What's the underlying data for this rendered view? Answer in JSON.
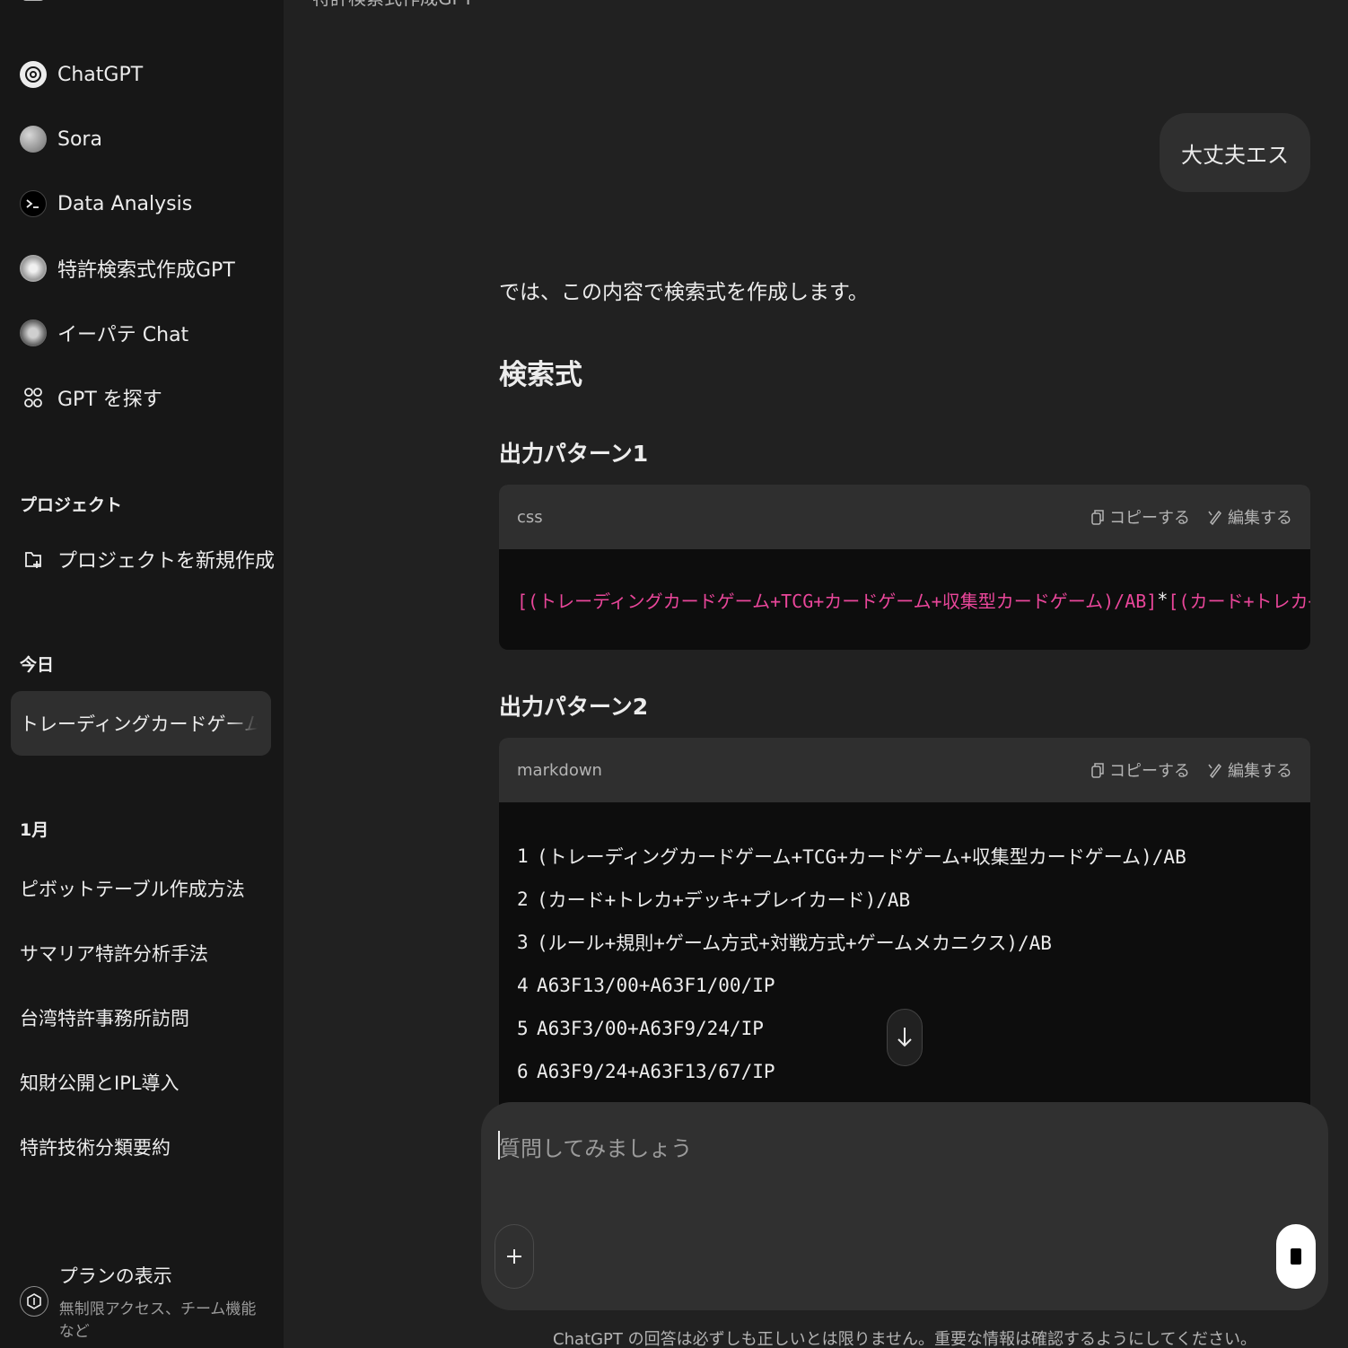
{
  "sidebar": {
    "gpts": [
      {
        "label": "ChatGPT",
        "icon": "openai-logo-icon"
      },
      {
        "label": "Sora",
        "icon": "sora-avatar"
      },
      {
        "label": "Data Analysis",
        "icon": "terminal-icon"
      },
      {
        "label": "特許検索式作成GPT",
        "icon": "gpt-avatar"
      },
      {
        "label": "イーパテ Chat",
        "icon": "gpt-avatar"
      },
      {
        "label": "GPT を探す",
        "icon": "grid-icon"
      }
    ],
    "projects_title": "プロジェクト",
    "new_project_label": "プロジェクトを新規作成",
    "today_title": "今日",
    "today_chats": [
      "トレーディングカードゲーム検索式"
    ],
    "month_title": "1月",
    "month_chats": [
      "ピボットテーブル作成方法",
      "サマリア特許分析手法",
      "台湾特許事務所訪問",
      "知財公開とIPL導入",
      "特許技術分類要約"
    ],
    "plan": {
      "title": "プランの表示",
      "subtitle": "無制限アクセス、チーム機能など"
    }
  },
  "main": {
    "header_title": "特許検索式作成GPT",
    "user_message": "大丈夫エス",
    "assistant_intro": "では、この内容で検索式を作成します。",
    "heading": "検索式",
    "pattern1_title": "出力パターン1",
    "pattern2_title": "出力パターン2",
    "code_actions": {
      "copy": "コピーする",
      "edit": "編集する"
    },
    "code1": {
      "lang": "css",
      "part_a": "[(トレーディングカードゲーム+TCG+カードゲーム+収集型カードゲーム)/AB]",
      "operator": "*",
      "part_b": "[(カード+トレカ+デッキ+プレイカード"
    },
    "code2": {
      "lang": "markdown",
      "lines": [
        {
          "n": "1",
          "text": "(トレーディングカードゲーム+TCG+カードゲーム+収集型カードゲーム)/AB"
        },
        {
          "n": "2",
          "text": "(カード+トレカ+デッキ+プレイカード)/AB"
        },
        {
          "n": "3",
          "text": "(ルール+規則+ゲーム方式+対戦方式+ゲームメカニクス)/AB"
        },
        {
          "n": "4",
          "text": "A63F13/00+A63F1/00/IP"
        },
        {
          "n": "5",
          "text": "A63F3/00+A63F9/24/IP"
        },
        {
          "n": "6",
          "text": "A63F9/24+A63F13/67/IP"
        }
      ]
    },
    "composer_placeholder": "質問してみましょう",
    "disclaimer": "ChatGPT の回答は必ずしも正しいとは限りません。重要な情報は確認するようにしてください。"
  },
  "colors": {
    "sidebar_bg": "#171717",
    "main_bg": "#212121",
    "code_string": "#e9469a",
    "bubble_bg": "#2f2f2f"
  }
}
